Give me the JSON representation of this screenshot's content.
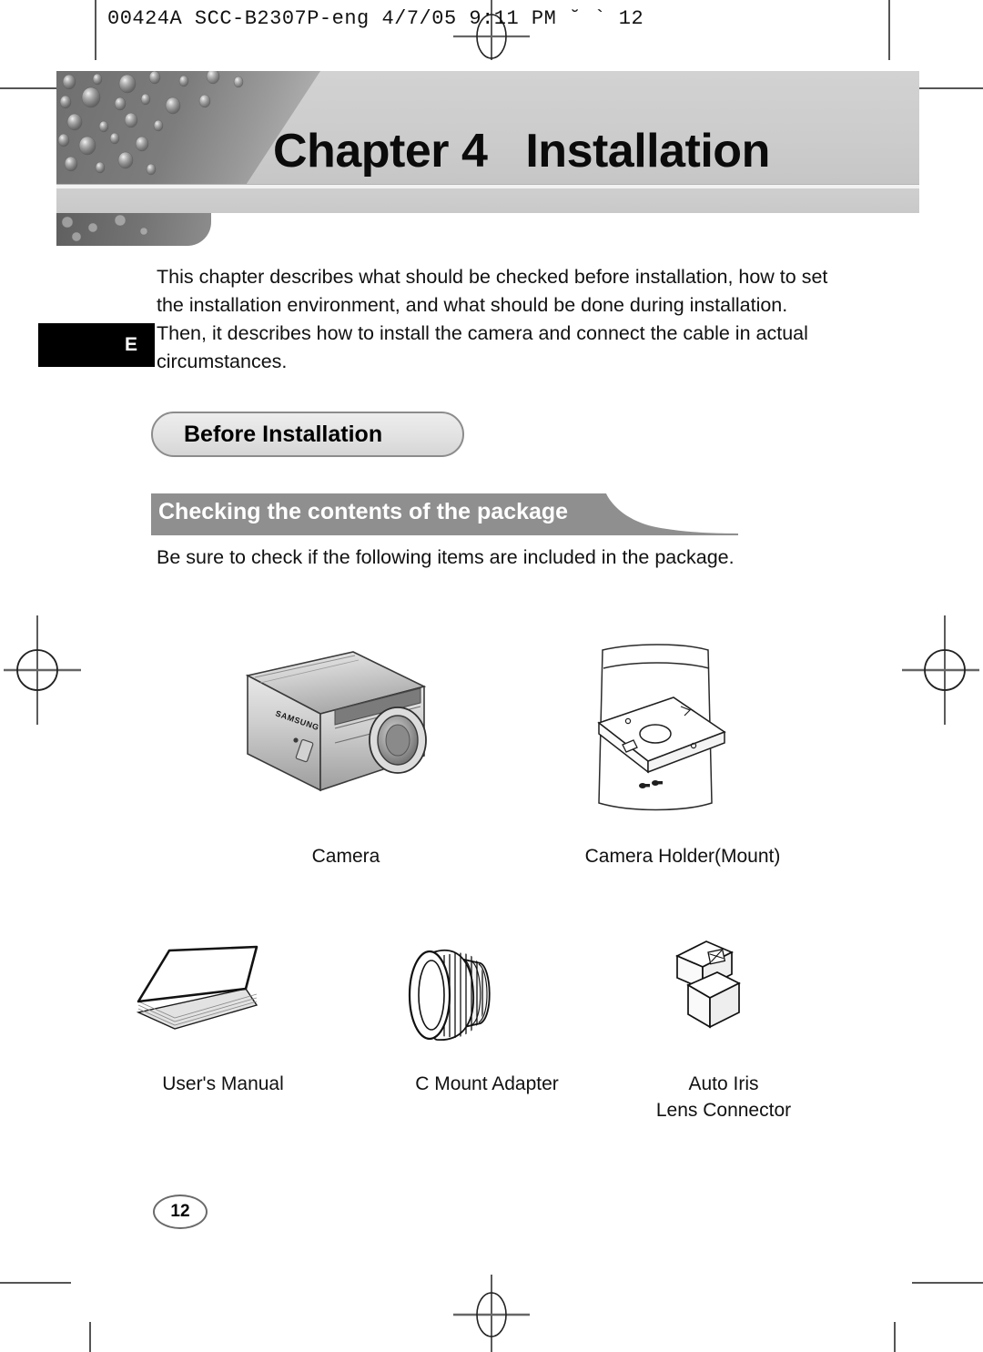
{
  "prepress": {
    "slug": "00424A SCC-B2307P-eng  4/7/05 9:11 PM  ˘   `   12"
  },
  "header": {
    "chapter_label": "Chapter",
    "chapter_number": "4",
    "chapter_title": "Installation"
  },
  "language_tab": {
    "label": "E"
  },
  "intro": {
    "paragraph": "This chapter describes what should be checked before installation, how to set the installation environment, and what should be done during installation. Then, it describes how to install the camera and connect the cable in actual circumstances."
  },
  "sections": {
    "pill_heading": "Before Installation",
    "banner_heading": "Checking the contents of the package",
    "lead_line": "Be sure to check if the following items are included in the package."
  },
  "package_items": [
    {
      "name": "camera",
      "caption": "Camera",
      "brand": "SAMSUNG"
    },
    {
      "name": "camera-holder",
      "caption": "Camera Holder(Mount)"
    },
    {
      "name": "users-manual",
      "caption": "User's Manual"
    },
    {
      "name": "c-mount-adapter",
      "caption": "C Mount Adapter"
    },
    {
      "name": "auto-iris-lens-connector",
      "caption_line1": "Auto Iris",
      "caption_line2": "Lens Connector"
    }
  ],
  "footer": {
    "page_number": "12"
  },
  "colors": {
    "header_light": "#cccccc",
    "header_dark": "#7d7d7d",
    "banner_gray": "#8f8f8f",
    "pill_border": "#8c8c8c",
    "text": "#111111"
  }
}
